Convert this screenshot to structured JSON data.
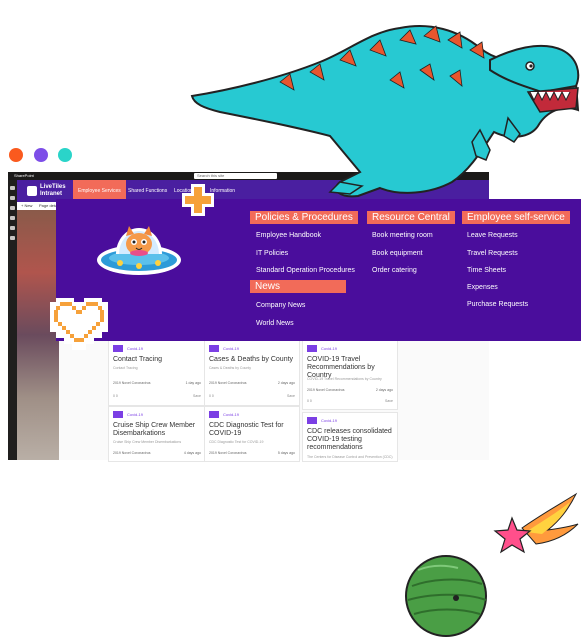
{
  "sharepoint_bar": {
    "app": "SharePoint",
    "search_placeholder": "Search this site"
  },
  "topnav": {
    "logo_line1": "LiveTiles",
    "logo_line2": "Intranet",
    "items": [
      "Employee Services",
      "Shared Functions",
      "Locations",
      "Information"
    ]
  },
  "commandbar": {
    "new": "+ New",
    "page_details": "Page details"
  },
  "menu": {
    "col1": {
      "heading": "Policies & Procedures",
      "items": [
        "Employee Handbook",
        "IT Policies",
        "Standard Operation Procedures"
      ]
    },
    "col1b": {
      "heading": "News",
      "items": [
        "Company News",
        "World News"
      ]
    },
    "col2": {
      "heading": "Resource Central",
      "items": [
        "Book meeting room",
        "Book equipment",
        "Order catering"
      ]
    },
    "col3": {
      "heading": "Employee self-service",
      "items": [
        "Leave Requests",
        "Travel Requests",
        "Time Sheets",
        "Expenses",
        "Purchase Requests"
      ]
    }
  },
  "cards": [
    {
      "category": "Covid-19",
      "title": "Contact Tracing",
      "subtitle": "Contact Tracing",
      "meta": "2019 Novel Coronavirus",
      "age": "1 day ago",
      "stats": "0   0",
      "action": "Save"
    },
    {
      "category": "Covid-19",
      "title": "Cases & Deaths by County",
      "subtitle": "Cases & Deaths by County",
      "meta": "2019 Novel Coronavirus",
      "age": "2 days ago",
      "stats": "0   0",
      "action": "Save"
    },
    {
      "category": "Covid-19",
      "title": "COVID-19 Travel Recommendations by Country",
      "subtitle": "COVID-19 Travel Recommendations by Country",
      "meta": "2019 Novel Coronavirus",
      "age": "2 days ago",
      "stats": "0   0",
      "action": "Save"
    },
    {
      "category": "Covid-19",
      "title": "Cruise Ship Crew Member Disembarkations",
      "subtitle": "Cruise Ship Crew Member Disembarkations",
      "meta": "2019 Novel Coronavirus",
      "age": "4 days ago",
      "stats": "",
      "action": ""
    },
    {
      "category": "Covid-19",
      "title": "CDC Diagnostic Test for COVID-19",
      "subtitle": "CDC Diagnostic Test for COVID-19",
      "meta": "2019 Novel Coronavirus",
      "age": "5 days ago",
      "stats": "",
      "action": ""
    },
    {
      "category": "Covid-19",
      "title": "CDC releases consolidated COVID-19 testing recommendations",
      "subtitle": "The Centers for Disease Control and Prevention (CDC)",
      "meta": "",
      "age": "",
      "stats": "",
      "action": ""
    }
  ],
  "colors": {
    "accent_purple": "#4a0d9c",
    "heading_coral": "#f26b59",
    "dino_cyan": "#27c9d2",
    "dino_orange": "#e8562e"
  },
  "decor": [
    "dots-red-purple-teal",
    "t-rex-illustration",
    "orange-plus-icon",
    "heart-pixel-icon",
    "cat-ufo-sticker",
    "planet-icon",
    "shooting-star-icon"
  ]
}
